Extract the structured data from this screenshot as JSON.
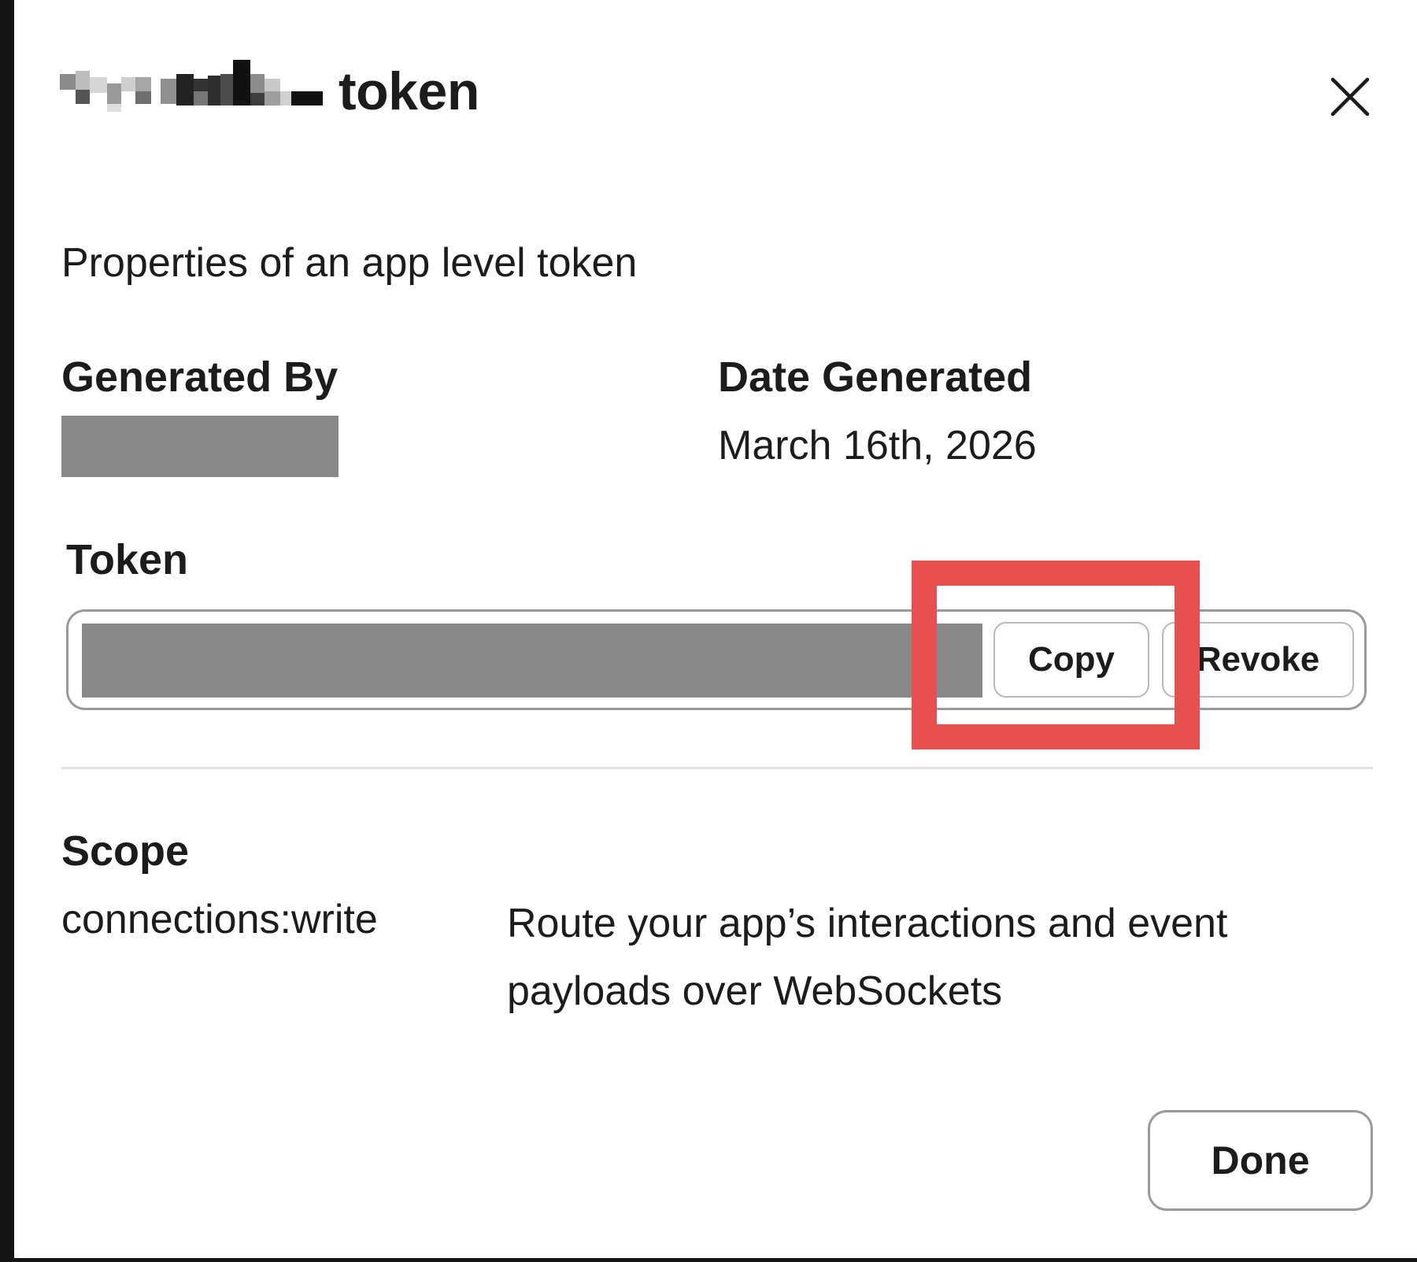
{
  "modal": {
    "title": "token",
    "close_icon": "close-icon",
    "subtitle": "Properties of an app level token",
    "generated_by": {
      "label": "Generated By"
    },
    "date_generated": {
      "label": "Date Generated",
      "value": "March 16th, 2026"
    },
    "token": {
      "label": "Token",
      "copy_label": "Copy",
      "revoke_label": "Revoke"
    },
    "scope": {
      "label": "Scope",
      "name": "connections:write",
      "description": "Route your app’s interactions and event payloads over WebSockets"
    },
    "done_label": "Done"
  },
  "colors": {
    "highlight": "#e85050",
    "redaction": "#888888",
    "text": "#1d1c1d"
  }
}
